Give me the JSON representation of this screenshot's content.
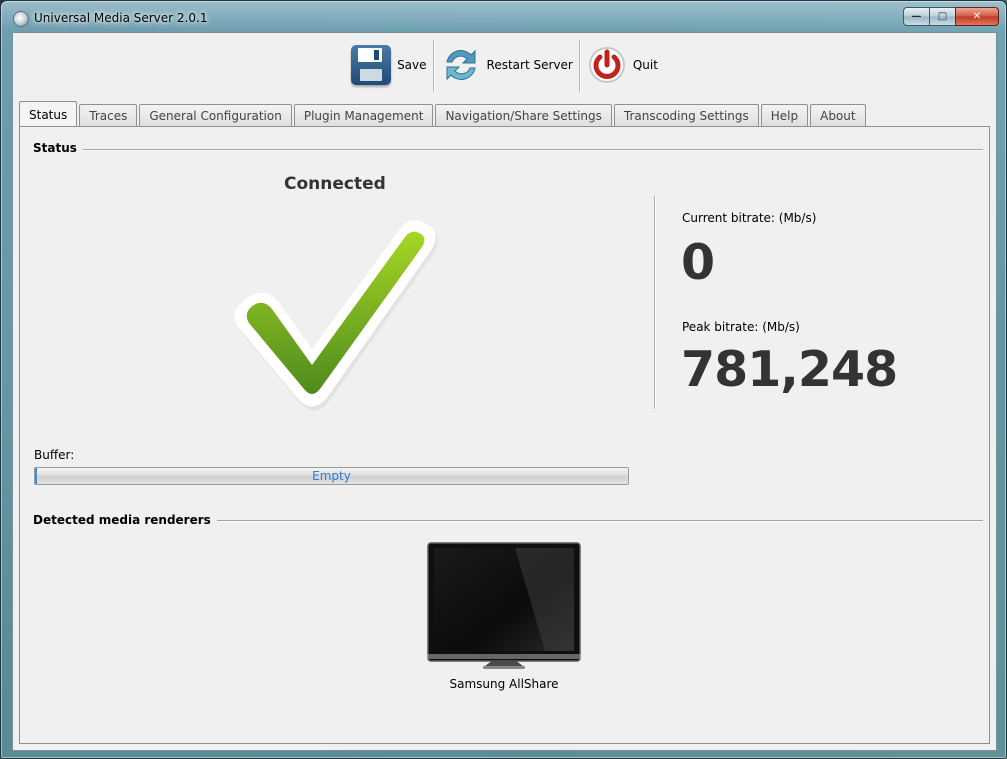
{
  "window": {
    "title": "Universal Media Server 2.0.1",
    "controls": [
      "minimize",
      "maximize",
      "close"
    ]
  },
  "toolbar": {
    "save_label": "Save",
    "restart_label": "Restart Server",
    "quit_label": "Quit"
  },
  "tabs": [
    {
      "label": "Status",
      "active": true
    },
    {
      "label": "Traces"
    },
    {
      "label": "General Configuration"
    },
    {
      "label": "Plugin Management"
    },
    {
      "label": "Navigation/Share Settings"
    },
    {
      "label": "Transcoding Settings"
    },
    {
      "label": "Help"
    },
    {
      "label": "About"
    }
  ],
  "status": {
    "section_title": "Status",
    "connection_text": "Connected",
    "connection_icon": "checkmark-icon",
    "current_bitrate_label": "Current bitrate: (Mb/s)",
    "current_bitrate_value": "0",
    "peak_bitrate_label": "Peak bitrate: (Mb/s)",
    "peak_bitrate_value": "781,248",
    "buffer_label": "Buffer:",
    "buffer_text": "Empty",
    "buffer_fill": 0.002
  },
  "renderers": {
    "section_title": "Detected media renderers",
    "items": [
      {
        "name": "Samsung AllShare",
        "icon": "tv-icon"
      }
    ]
  },
  "colors": {
    "accent_green": "#7fbf1e",
    "progress_text": "#2a7ae2",
    "close_button": "#c0391f"
  }
}
